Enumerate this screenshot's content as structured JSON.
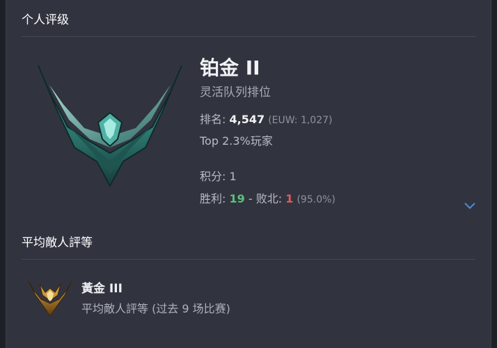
{
  "section_title": "个人评级",
  "rank": {
    "tier": "铂金 II",
    "queue": "灵活队列排位",
    "ladder_label": "排名:",
    "ladder_value": "4,547",
    "region_rank": "(EUW: 1,027)",
    "top_percent": "Top 2.3%玩家",
    "points": "积分: 1",
    "wins_label": "胜利:",
    "wins": "19",
    "separator": "-",
    "losses_label": "败北:",
    "losses": "1",
    "winrate": "(95.0%)",
    "emblem_icon": "platinum-emblem-icon"
  },
  "avg_section_title": "平均敵人評等",
  "avg_enemy": {
    "tier": "黃金 III",
    "description": "平均敵人評等 (过去 9 场比赛)",
    "emblem_icon": "gold-emblem-icon"
  },
  "colors": {
    "background": "#31343f",
    "win": "#58c47a",
    "loss": "#e55a5a",
    "accent": "#4a8fd8"
  }
}
